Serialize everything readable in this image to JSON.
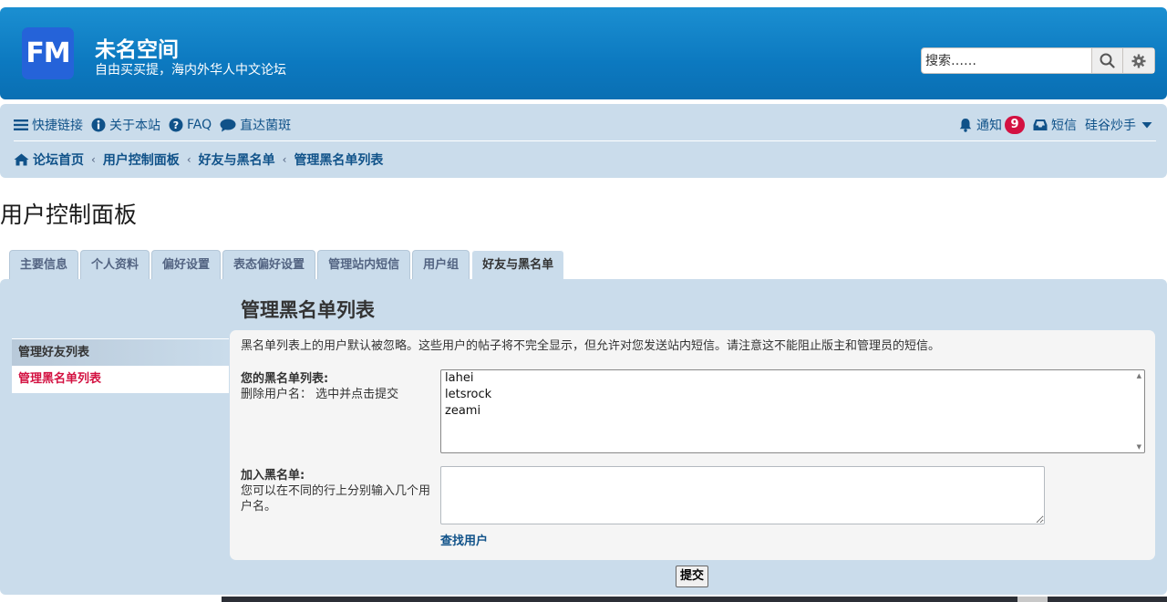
{
  "header": {
    "logo_text": "FM",
    "site_title": "未名空间",
    "site_description": "自由买买提，海内外华人中文论坛",
    "search_placeholder": "搜索……"
  },
  "nav": {
    "links": [
      {
        "label": "快捷链接",
        "icon": "bars-icon"
      },
      {
        "label": "关于本站",
        "icon": "info-icon"
      },
      {
        "label": "FAQ",
        "icon": "question-icon"
      },
      {
        "label": "直达菌斑",
        "icon": "chat-icon"
      }
    ],
    "notifications_label": "通知",
    "notifications_count": "9",
    "messages_label": "短信",
    "username": "硅谷炒手"
  },
  "breadcrumbs": [
    "论坛首页",
    "用户控制面板",
    "好友与黑名单",
    "管理黑名单列表"
  ],
  "page_title": "用户控制面板",
  "tabs": [
    "主要信息",
    "个人资料",
    "偏好设置",
    "表态偏好设置",
    "管理站内短信",
    "用户组",
    "好友与黑名单"
  ],
  "active_tab": "好友与黑名单",
  "side_menu": [
    {
      "label": "管理好友列表",
      "active": false
    },
    {
      "label": "管理黑名单列表",
      "active": true
    }
  ],
  "section": {
    "title": "管理黑名单列表",
    "description": "黑名单列表上的用户默认被忽略。这些用户的帖子将不完全显示，但允许对您发送站内短信。请注意这不能阻止版主和管理员的短信。",
    "your_list_label": "您的黑名单列表:",
    "your_list_hint": "删除用户名： 选中并点击提交",
    "blacklist": [
      "lahei",
      "letsrock",
      "zeami"
    ],
    "add_label": "加入黑名单:",
    "add_hint": "您可以在不同的行上分别输入几个用户名。",
    "find_user": "查找用户",
    "submit": "提交"
  },
  "colors": {
    "header_blue": "#0c79c0",
    "nav_bg": "#cadceb",
    "link": "#105289",
    "active_red": "#d31141",
    "logo_bg": "#2563d9"
  }
}
